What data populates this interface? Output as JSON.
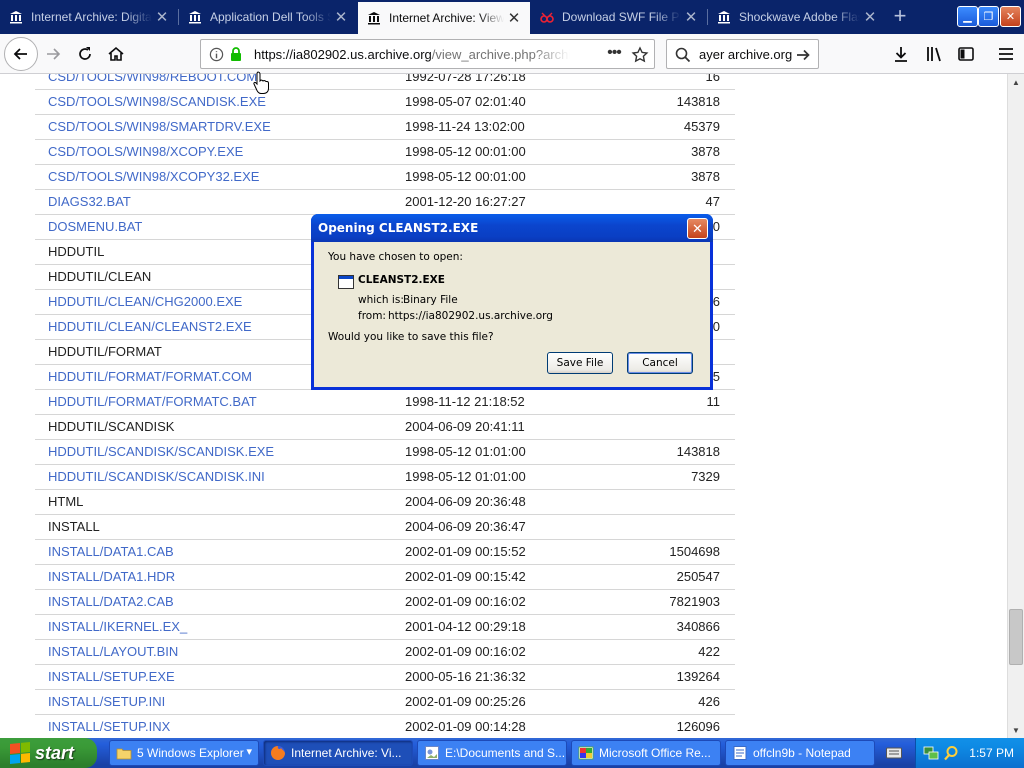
{
  "browser": {
    "tabs": [
      {
        "label": "Internet Archive: Digital Lib",
        "icon": "archive-icon",
        "active": false
      },
      {
        "label": "Application Dell Tools Sy",
        "icon": "archive-icon",
        "active": false
      },
      {
        "label": "Internet Archive: View A",
        "icon": "archive-icon",
        "active": true
      },
      {
        "label": "Download SWF File Play",
        "icon": "swf-icon",
        "active": false
      },
      {
        "label": "Shockwave Adobe Flash",
        "icon": "archive-icon",
        "active": false
      }
    ],
    "url_host": "https://ia802902.us.archive.org",
    "url_path": "/view_archive.php?archive=",
    "search_text": "ayer archive.org"
  },
  "listing": {
    "rows": [
      {
        "name": "CSD/TOOLS/WIN98/REBOOT.COM",
        "date": "1992-07-28 17:26:18",
        "size": "16",
        "is_link": true
      },
      {
        "name": "CSD/TOOLS/WIN98/SCANDISK.EXE",
        "date": "1998-05-07 02:01:40",
        "size": "143818",
        "is_link": true
      },
      {
        "name": "CSD/TOOLS/WIN98/SMARTDRV.EXE",
        "date": "1998-11-24 13:02:00",
        "size": "45379",
        "is_link": true
      },
      {
        "name": "CSD/TOOLS/WIN98/XCOPY.EXE",
        "date": "1998-05-12 00:01:00",
        "size": "3878",
        "is_link": true
      },
      {
        "name": "CSD/TOOLS/WIN98/XCOPY32.EXE",
        "date": "1998-05-12 00:01:00",
        "size": "3878",
        "is_link": true
      },
      {
        "name": "DIAGS32.BAT",
        "date": "2001-12-20 16:27:27",
        "size": "47",
        "is_link": true
      },
      {
        "name": "DOSMENU.BAT",
        "date": "",
        "size": "0",
        "is_link": true
      },
      {
        "name": "HDDUTIL",
        "date": "",
        "size": "",
        "is_link": false
      },
      {
        "name": "HDDUTIL/CLEAN",
        "date": "",
        "size": "",
        "is_link": false
      },
      {
        "name": "HDDUTIL/CLEAN/CHG2000.EXE",
        "date": "",
        "size": "6",
        "is_link": true
      },
      {
        "name": "HDDUTIL/CLEAN/CLEANST2.EXE",
        "date": "",
        "size": "0",
        "is_link": true
      },
      {
        "name": "HDDUTIL/FORMAT",
        "date": "",
        "size": "",
        "is_link": false
      },
      {
        "name": "HDDUTIL/FORMAT/FORMAT.COM",
        "date": "",
        "size": "5",
        "is_link": true
      },
      {
        "name": "HDDUTIL/FORMAT/FORMATC.BAT",
        "date": "1998-11-12 21:18:52",
        "size": "11",
        "is_link": true
      },
      {
        "name": "HDDUTIL/SCANDISK",
        "date": "2004-06-09 20:41:11",
        "size": "",
        "is_link": false
      },
      {
        "name": "HDDUTIL/SCANDISK/SCANDISK.EXE",
        "date": "1998-05-12 01:01:00",
        "size": "143818",
        "is_link": true
      },
      {
        "name": "HDDUTIL/SCANDISK/SCANDISK.INI",
        "date": "1998-05-12 01:01:00",
        "size": "7329",
        "is_link": true
      },
      {
        "name": "HTML",
        "date": "2004-06-09 20:36:48",
        "size": "",
        "is_link": false
      },
      {
        "name": "INSTALL",
        "date": "2004-06-09 20:36:47",
        "size": "",
        "is_link": false
      },
      {
        "name": "INSTALL/DATA1.CAB",
        "date": "2002-01-09 00:15:52",
        "size": "1504698",
        "is_link": true
      },
      {
        "name": "INSTALL/DATA1.HDR",
        "date": "2002-01-09 00:15:42",
        "size": "250547",
        "is_link": true
      },
      {
        "name": "INSTALL/DATA2.CAB",
        "date": "2002-01-09 00:16:02",
        "size": "7821903",
        "is_link": true
      },
      {
        "name": "INSTALL/IKERNEL.EX_",
        "date": "2001-04-12 00:29:18",
        "size": "340866",
        "is_link": true
      },
      {
        "name": "INSTALL/LAYOUT.BIN",
        "date": "2002-01-09 00:16:02",
        "size": "422",
        "is_link": true
      },
      {
        "name": "INSTALL/SETUP.EXE",
        "date": "2000-05-16 21:36:32",
        "size": "139264",
        "is_link": true
      },
      {
        "name": "INSTALL/SETUP.INI",
        "date": "2002-01-09 00:25:26",
        "size": "426",
        "is_link": true
      },
      {
        "name": "INSTALL/SETUP.INX",
        "date": "2002-01-09 00:14:28",
        "size": "126096",
        "is_link": true
      }
    ]
  },
  "dialog": {
    "title": "Opening CLEANST2.EXE",
    "intro": "You have chosen to open:",
    "filename": "CLEANST2.EXE",
    "which_is_label": "which is:",
    "which_is_value": "Binary File",
    "from_label": "from:",
    "from_value": "https://ia802902.us.archive.org",
    "question": "Would you like to save this file?",
    "save_label": "Save File",
    "cancel_label": "Cancel"
  },
  "taskbar": {
    "start_label": "start",
    "tasks": [
      {
        "label": "5 Windows Explorer",
        "icon": "folder-icon",
        "active": false
      },
      {
        "label": "Internet Archive: Vi...",
        "icon": "firefox-icon",
        "active": true
      },
      {
        "label": "E:\\Documents and S...",
        "icon": "image-icon",
        "active": false
      },
      {
        "label": "Microsoft Office Re...",
        "icon": "office-icon",
        "active": false
      },
      {
        "label": "offcln9b - Notepad",
        "icon": "notepad-icon",
        "active": false
      }
    ],
    "clock": "1:57 PM"
  },
  "colors": {
    "link": "#4169c8",
    "tabstrip": "#0a246a",
    "xp_title": "#0a45cd",
    "taskbar": "#245edb",
    "start_green": "#3a9a37"
  }
}
